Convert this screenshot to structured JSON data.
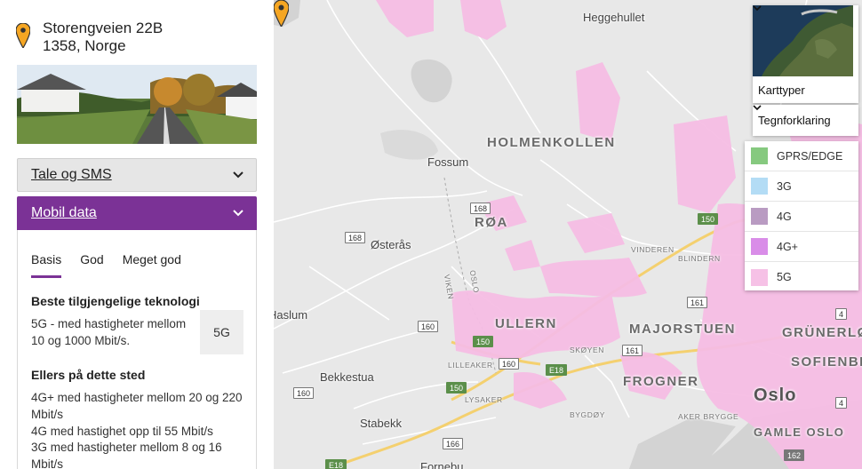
{
  "address": {
    "line1": "Storengveien 22B",
    "line2": "1358, Norge"
  },
  "accordion": {
    "voice_label": "Tale og SMS",
    "data_label": "Mobil data"
  },
  "tabs": [
    "Basis",
    "God",
    "Meget god"
  ],
  "best_tech": {
    "heading": "Beste tilgjengelige teknologi",
    "text": "5G - med hastigheter mellom 10 og 1000 Mbit/s.",
    "badge": "5G"
  },
  "other": {
    "heading": "Ellers på dette sted",
    "items": [
      "4G+ med hastigheter mellom 20 og 220 Mbit/s",
      "4G med hastighet opp til 55 Mbit/s",
      "3G med hastigheter mellom 8 og 16 Mbit/s"
    ]
  },
  "map": {
    "places": {
      "heggehullet": "Heggehullet",
      "holmenkollen": "HOLMENKOLLEN",
      "fossum": "Fossum",
      "roa": "RØA",
      "osteras": "Østerås",
      "ullern": "ULLERN",
      "majorstuen": "MAJORSTUEN",
      "grunerlokka": "GRÜNERLØ",
      "sofienberg": "SOFIENBE",
      "frogner": "FROGNER",
      "oslo": "Oslo",
      "gamle_oslo": "GAMLE OSLO",
      "bekkestua": "Bekkestua",
      "stabekk": "Stabekk",
      "haslum": "Haslum",
      "fornebu": "Fornebu",
      "vinderen": "VINDEREN",
      "blindern": "BLINDERN",
      "skoyen": "SKØYEN",
      "lilleaker": "LILLEAKER",
      "lysaker": "LYSAKER",
      "bygdoy": "BYGDØY",
      "aker_brygge": "AKER BRYGGE",
      "viken": "VIKEN",
      "oslo_border": "OSLO"
    },
    "roads": [
      "168",
      "168",
      "150",
      "160",
      "150",
      "160",
      "150",
      "161",
      "161",
      "4",
      "160",
      "166",
      "E18",
      "E18",
      "162",
      "4"
    ]
  },
  "controls": {
    "map_types": "Karttyper",
    "legend": "Tegnforklaring"
  },
  "legend": [
    {
      "label": "GPRS/EDGE",
      "color": "#86c97f"
    },
    {
      "label": "3G",
      "color": "#b3dcf5"
    },
    {
      "label": "4G",
      "color": "#b99bc2"
    },
    {
      "label": "4G+",
      "color": "#d98de8"
    },
    {
      "label": "5G",
      "color": "#f6c1e6"
    }
  ]
}
